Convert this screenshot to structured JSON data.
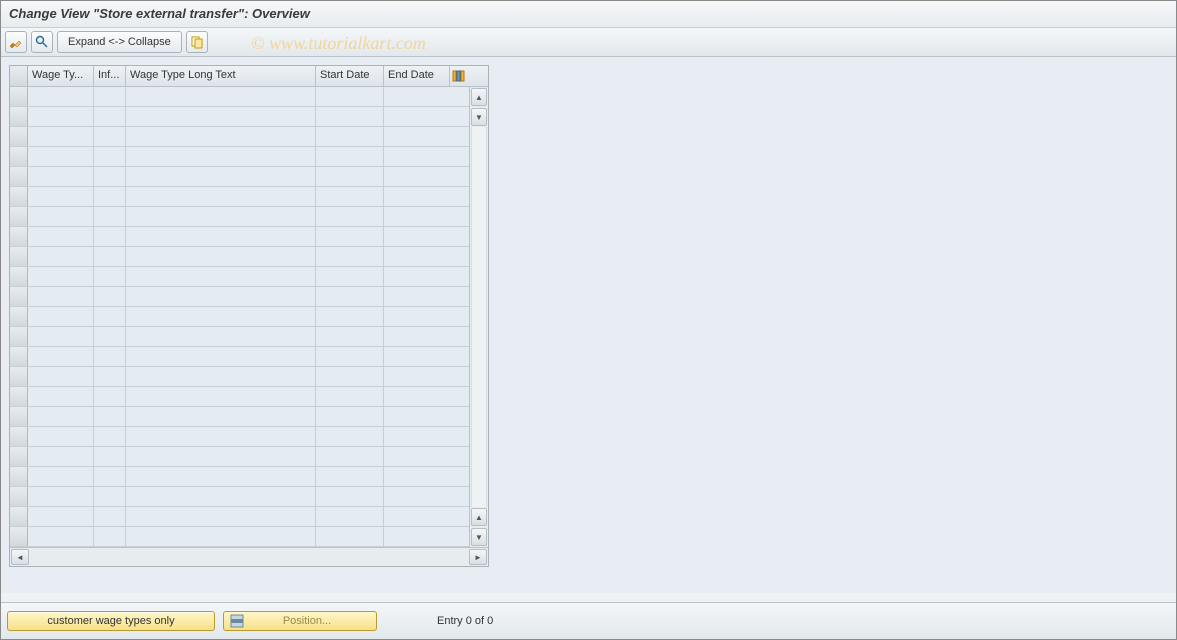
{
  "title": "Change View \"Store external transfer\": Overview",
  "watermark": "©  www.tutorialkart.com",
  "toolbar": {
    "change_icon": "change-icon",
    "find_icon": "find-icon",
    "expand_label": "Expand <-> Collapse",
    "copy_icon": "copy-icon"
  },
  "table": {
    "columns": {
      "wage_type": "Wage Ty...",
      "inf": "Inf...",
      "long_text": "Wage Type Long Text",
      "start_date": "Start Date",
      "end_date": "End Date"
    },
    "config_icon": "configure-columns-icon",
    "row_count": 23
  },
  "footer": {
    "customer_button": "customer wage types only",
    "position_button": "Position...",
    "position_icon": "position-icon",
    "status": "Entry 0 of 0"
  }
}
